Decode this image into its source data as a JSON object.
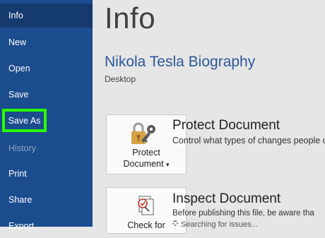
{
  "sidebar": {
    "items": [
      {
        "label": "Info"
      },
      {
        "label": "New"
      },
      {
        "label": "Open"
      },
      {
        "label": "Save"
      },
      {
        "label": "Save As"
      },
      {
        "label": "History"
      },
      {
        "label": "Print"
      },
      {
        "label": "Share"
      },
      {
        "label": "Export"
      }
    ]
  },
  "main": {
    "title": "Info",
    "doc_name": "Nikola Tesla Biography",
    "doc_location": "Desktop",
    "protect": {
      "button_line1": "Protect",
      "button_line2": "Document",
      "dropdown_glyph": "▾",
      "title": "Protect Document",
      "description": "Control what types of changes people c"
    },
    "inspect": {
      "button_line1": "Check for",
      "title": "Inspect Document",
      "description": "Before publishing this file, be aware tha",
      "status": "Searching for issues..."
    }
  },
  "colors": {
    "sidebar": "#1b4c8e",
    "highlight": "#2bff00",
    "accent": "#2b579a"
  },
  "icons": [
    "lock-key-icon",
    "inspect-document-icon",
    "loading-spinner-icon"
  ]
}
